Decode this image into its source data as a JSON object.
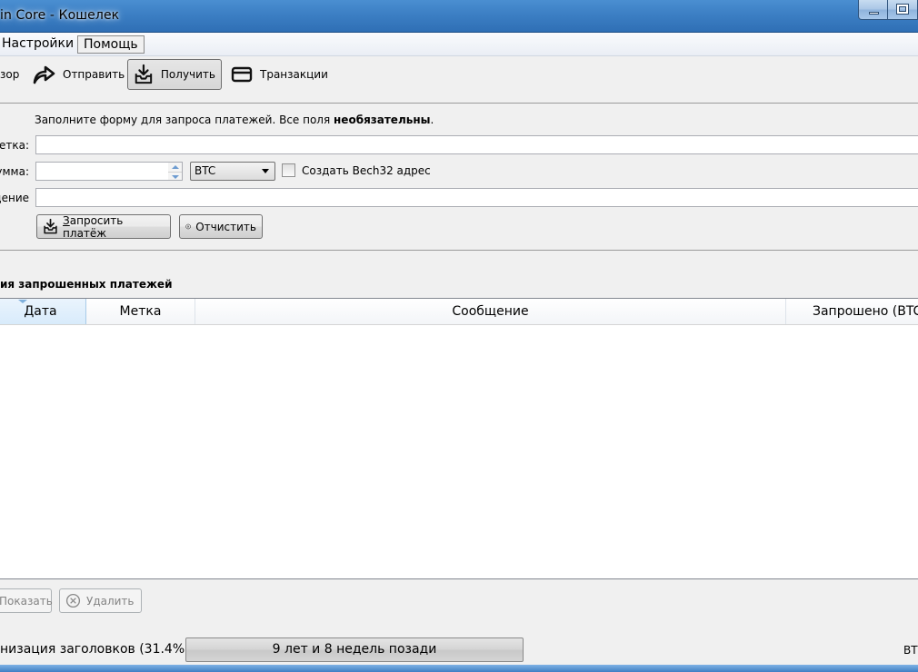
{
  "window": {
    "title": "in Core - Кошелек"
  },
  "menu": {
    "items": [
      "Настройки",
      "Помощь"
    ]
  },
  "toolbar": {
    "overview": "зор",
    "send": "Отправить",
    "receive": "Получить",
    "transactions": "Транзакции"
  },
  "form": {
    "intro_prefix": "Заполните форму для запроса платежей. Все поля ",
    "intro_bold": "необязательны",
    "intro_suffix": ".",
    "label_label": "етка:",
    "amount_label": "умма:",
    "message_label": "щение",
    "label_value": "",
    "amount_value": "",
    "message_value": "",
    "unit": "BTC",
    "bech32_label": "Создать Bech32 адрес",
    "bech32_checked": false,
    "request_button_accel": "З",
    "request_button_rest": "апросить платёж",
    "clear_button": "Отчистить"
  },
  "history": {
    "title": "ия запрошенных платежей",
    "columns": [
      "Дата",
      "Метка",
      "Сообщение",
      "Запрошено (BTC"
    ],
    "sorted_column": "Дата",
    "rows": []
  },
  "actions": {
    "show": "Показать",
    "remove": "Удалить"
  },
  "status": {
    "sync_text": "низация заголовков (31.4%)...",
    "progress_text": "9 лет и 8 недель позади",
    "unit": "BT"
  }
}
